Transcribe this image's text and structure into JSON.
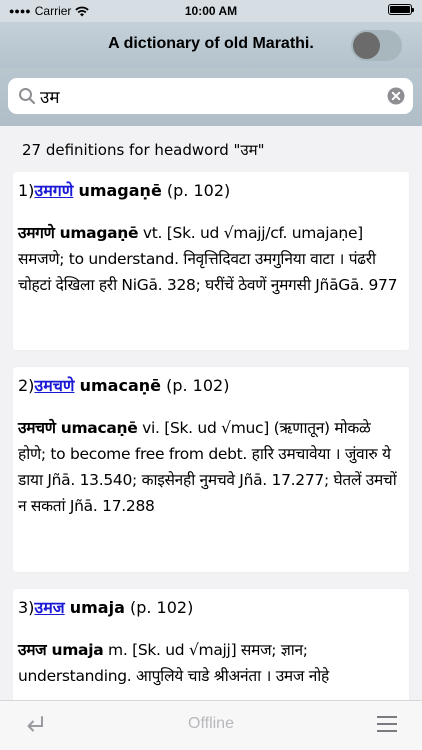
{
  "status_bar": {
    "carrier": "Carrier",
    "time": "10:00 AM"
  },
  "nav": {
    "title": "A dictionary of old Marathi.",
    "toggle_on": false
  },
  "search": {
    "value": "उम"
  },
  "summary": "27 definitions for headword \"उम\"",
  "entries": [
    {
      "index": "1)",
      "headword": "उमगणे",
      "translit": "umagaṇē",
      "page": "(p. 102)",
      "def_bold": "उमगणे umagaṇē",
      "def_text": " vt. [Sk. ud √majj/cf. umajaṇe] समजणे; to understand. निवृत्तिदिवटा उमगुनिया वाटा । पंढरी चोहटां देखिला हरी NiGā. 328; घरींचें ठेवणें नुमगसी JñāGā. 977"
    },
    {
      "index": "2)",
      "headword": "उमचणे",
      "translit": "umacaṇē",
      "page": "(p. 102)",
      "def_bold": "उमचणे umacaṇē",
      "def_text": " vi. [Sk. ud √muc] (ऋणातून) मोकळे होणे; to become free from debt. हारि उमचावेया । जुंवारु ये डाया Jñā. 13.540; काइसेनही नुमचवे Jñā. 17.277; घेतलें उमचों न सकतां Jñā. 17.288"
    },
    {
      "index": "3)",
      "headword": "उमज",
      "translit": "umaja",
      "page": "(p. 102)",
      "def_bold": "उमज umaja",
      "def_text": " m. [Sk. ud √majj] समज; ज्ञान; understanding. आपुलिये चाडे श्रीअनंता । उमज नोहे"
    }
  ],
  "toolbar": {
    "offline_label": "Offline"
  },
  "colors": {
    "link": "#1a1ad6",
    "nav_bg": "#c5d1d9",
    "toggle_knob": "#6b6b6b"
  },
  "icons": {
    "search": "magnifier-icon",
    "clear": "clear-circle-icon",
    "back": "return-arrow-icon",
    "menu": "hamburger-icon"
  }
}
